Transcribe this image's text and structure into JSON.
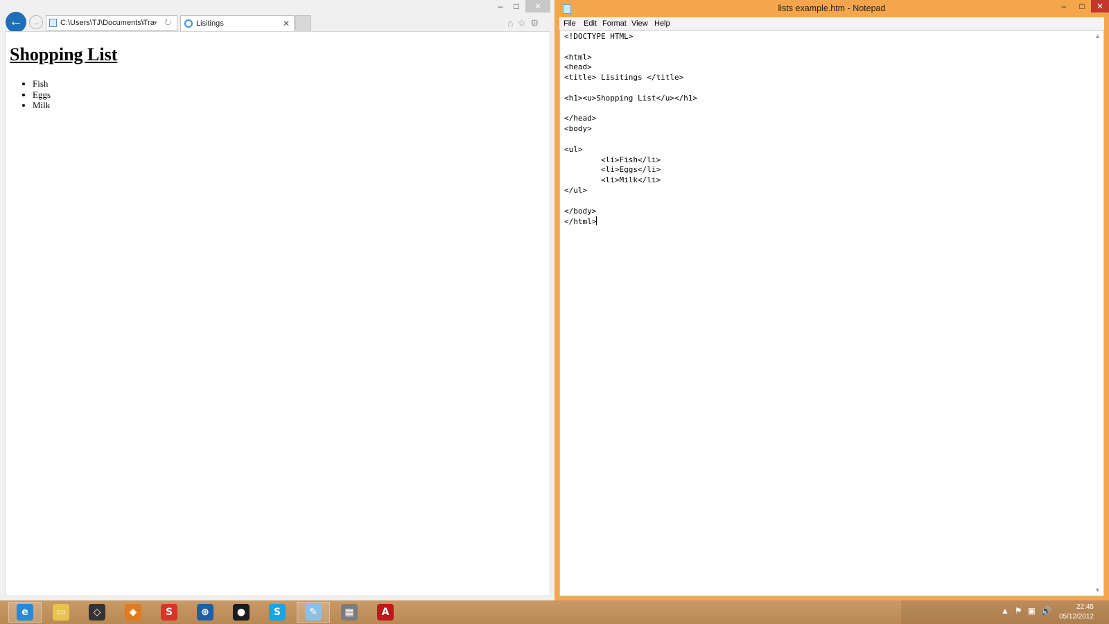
{
  "browser": {
    "address": "C:\\Users\\TJ\\Documents\\Tra",
    "address_tools": "⌕ ▾ ↻",
    "tab_title": "Lisitings",
    "tab_close": "✕",
    "back_icon": "←",
    "forward_icon": "→",
    "toolbar_icons": "⌂☆⚙",
    "window_buttons": {
      "minimize": "–",
      "maximize": "□",
      "close": "✕"
    },
    "page": {
      "heading": "Shopping List",
      "items": [
        "Fish",
        "Eggs",
        "Milk"
      ]
    }
  },
  "notepad": {
    "title": "lists example.htm - Notepad",
    "window_buttons": {
      "minimize": "–",
      "maximize": "□",
      "close": "✕"
    },
    "menu": [
      "File",
      "Edit",
      "Format",
      "View",
      "Help"
    ],
    "content": "<!DOCTYPE HTML>\n\n<html>\n<head>\n<title> Lisitings </title>\n\n<h1><u>Shopping List</u></h1>\n\n</head>\n<body>\n\n<ul>\n        <li>Fish</li>\n        <li>Eggs</li>\n        <li>Milk</li>\n</ul>\n\n</body>\n</html>"
  },
  "taskbar": {
    "apps": [
      {
        "name": "internet-explorer-icon",
        "glyph": "e",
        "color": "#2a8ad6",
        "open": true
      },
      {
        "name": "file-explorer-icon",
        "glyph": "▭",
        "color": "#e9c34d",
        "open": false
      },
      {
        "name": "unity-icon",
        "glyph": "◇",
        "color": "#333333",
        "open": false
      },
      {
        "name": "blender-icon",
        "glyph": "◆",
        "color": "#e07b1f",
        "open": false
      },
      {
        "name": "sketchup-icon",
        "glyph": "S",
        "color": "#d8342a",
        "open": false
      },
      {
        "name": "network-app-icon",
        "glyph": "⊕",
        "color": "#1f5fa8",
        "open": false
      },
      {
        "name": "steam-icon",
        "glyph": "●",
        "color": "#1c1c1c",
        "open": false
      },
      {
        "name": "skype-icon",
        "glyph": "S",
        "color": "#16a5e5",
        "open": false
      },
      {
        "name": "notepad-icon",
        "glyph": "✎",
        "color": "#8cc1e3",
        "open": true
      },
      {
        "name": "game-icon",
        "glyph": "▦",
        "color": "#7c7c7c",
        "open": false
      },
      {
        "name": "adobe-reader-icon",
        "glyph": "A",
        "color": "#c0181b",
        "open": false
      }
    ],
    "tray_icons": "▲⚑▣🔊",
    "time": "22:45",
    "date": "05/12/2012"
  },
  "colors": {
    "notepad_frame": "#f5a64c",
    "close_button": "#c4352b",
    "ie_back_button": "#1f6fb8"
  }
}
